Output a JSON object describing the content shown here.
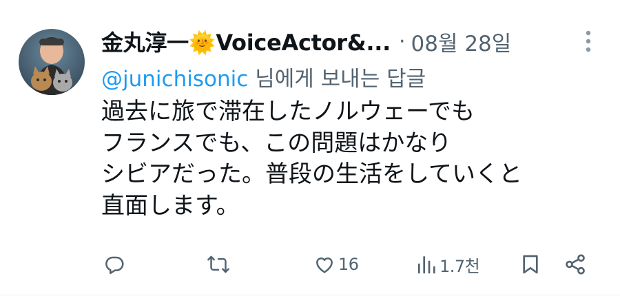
{
  "tweet": {
    "display_name": "金丸淳一🌞VoiceActor&...",
    "separator": "·",
    "timestamp": "08월 28일",
    "reply_handle": "@junichisonic",
    "reply_suffix": "님에게 보내는 답글",
    "lines": [
      "過去に旅で滞在したノルウェーでも",
      "フランスでも、この問題はかなり",
      "シビアだった。普段の生活をしていくと",
      "直面します。"
    ]
  },
  "actions": {
    "reply_icon": "reply-icon",
    "retweet_icon": "retweet-icon",
    "like_icon": "heart-icon",
    "like_count": "16",
    "views_icon": "views-icon",
    "views_count": "1.7천",
    "bookmark_icon": "bookmark-icon",
    "share_icon": "share-icon"
  },
  "colors": {
    "link": "#1d9bf0",
    "secondary_text": "#536471",
    "primary_text": "#0f1419"
  }
}
